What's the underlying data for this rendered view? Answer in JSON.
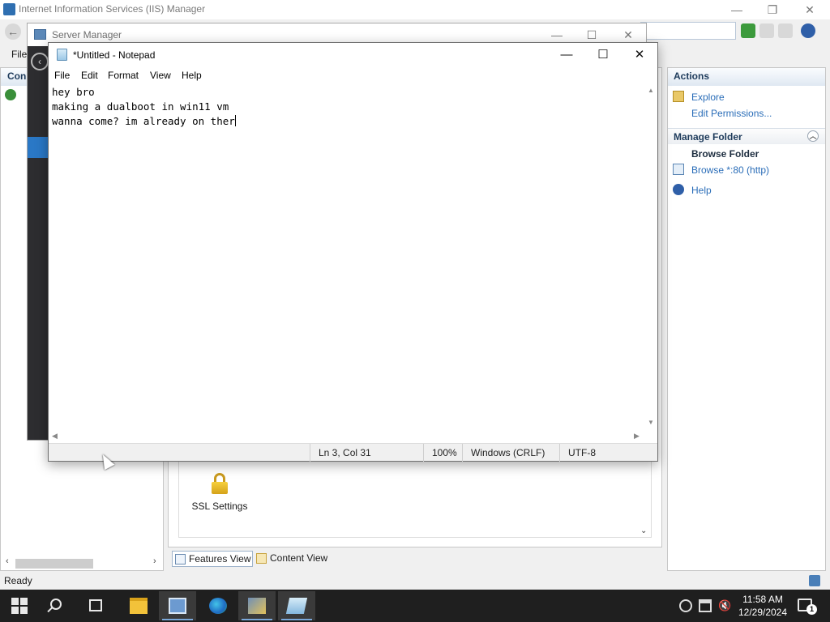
{
  "iis": {
    "title": "Internet Information Services (IIS) Manager",
    "menu_file": "File",
    "connections_header": "Conn",
    "actions": {
      "header": "Actions",
      "explore": "Explore",
      "edit_permissions": "Edit Permissions...",
      "manage_folder": "Manage Folder",
      "browse_folder": "Browse Folder",
      "browse_80": "Browse *:80 (http)",
      "help": "Help"
    },
    "features": {
      "ssl_settings": "SSL Settings"
    },
    "tabs": {
      "features_view": "Features View",
      "content_view": "Content View"
    },
    "status": "Ready"
  },
  "server_manager": {
    "title": "Server Manager"
  },
  "notepad": {
    "title": "*Untitled - Notepad",
    "menu": [
      "File",
      "Edit",
      "Format",
      "View",
      "Help"
    ],
    "lines": [
      "hey bro",
      "making a dualboot in win11 vm",
      "wanna come? im already on ther"
    ],
    "status": {
      "position": "Ln 3, Col 31",
      "zoom": "100%",
      "line_ending": "Windows (CRLF)",
      "encoding": "UTF-8"
    }
  },
  "taskbar": {
    "time": "11:58 AM",
    "date": "12/29/2024",
    "notification_count": "1"
  },
  "colors": {
    "accent": "#2a78c6",
    "taskbar": "#1f1f1f",
    "link": "#2a6db8"
  }
}
